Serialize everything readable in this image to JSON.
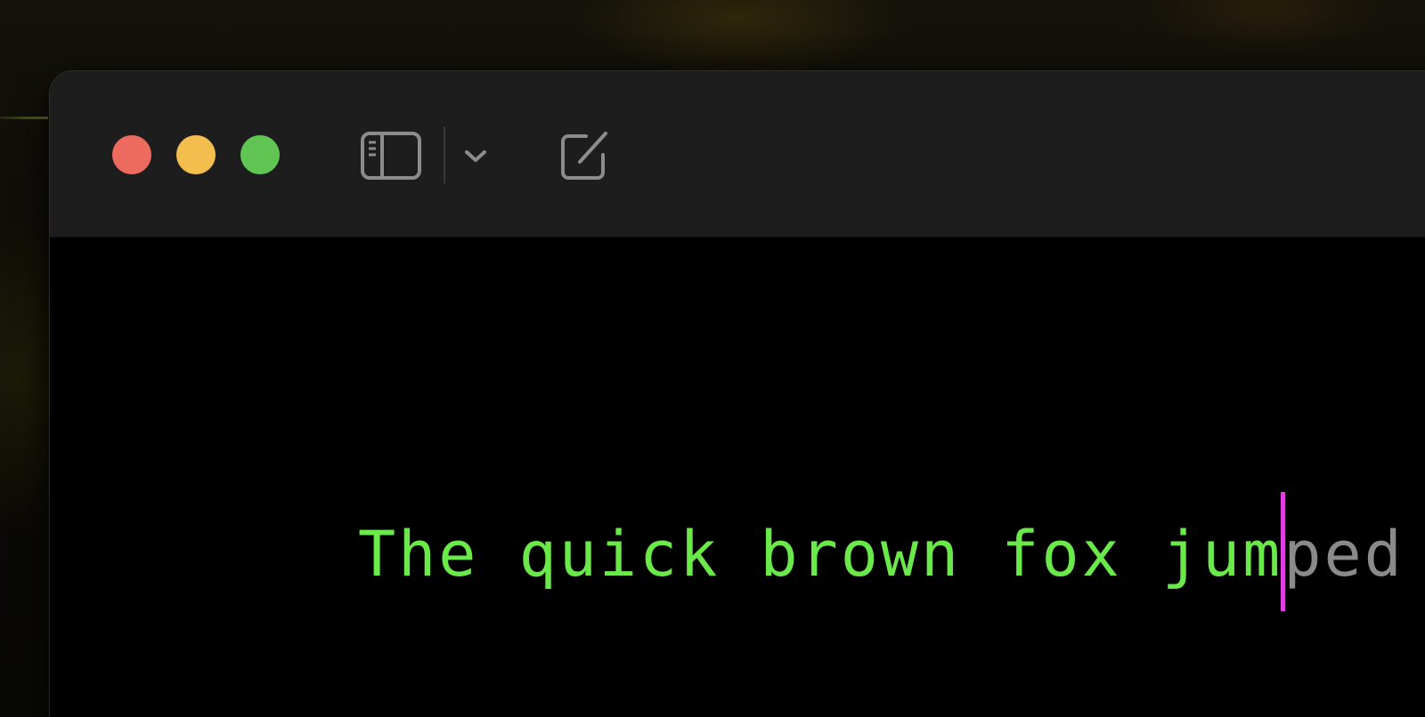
{
  "window": {
    "controls": {
      "close": "close",
      "minimize": "minimize",
      "zoom": "zoom"
    },
    "toolbar": {
      "sidebar_icon": "sidebar-toggle-icon",
      "chevron_icon": "chevron-down-icon",
      "compose_icon": "compose-icon"
    }
  },
  "editor": {
    "typed_text": "The quick brown fox jum",
    "suggestion_text": "ped",
    "colors": {
      "typed": "#6be94b",
      "suggestion": "#8a8a8a",
      "caret": "#e23ee4",
      "background": "#000000"
    }
  }
}
